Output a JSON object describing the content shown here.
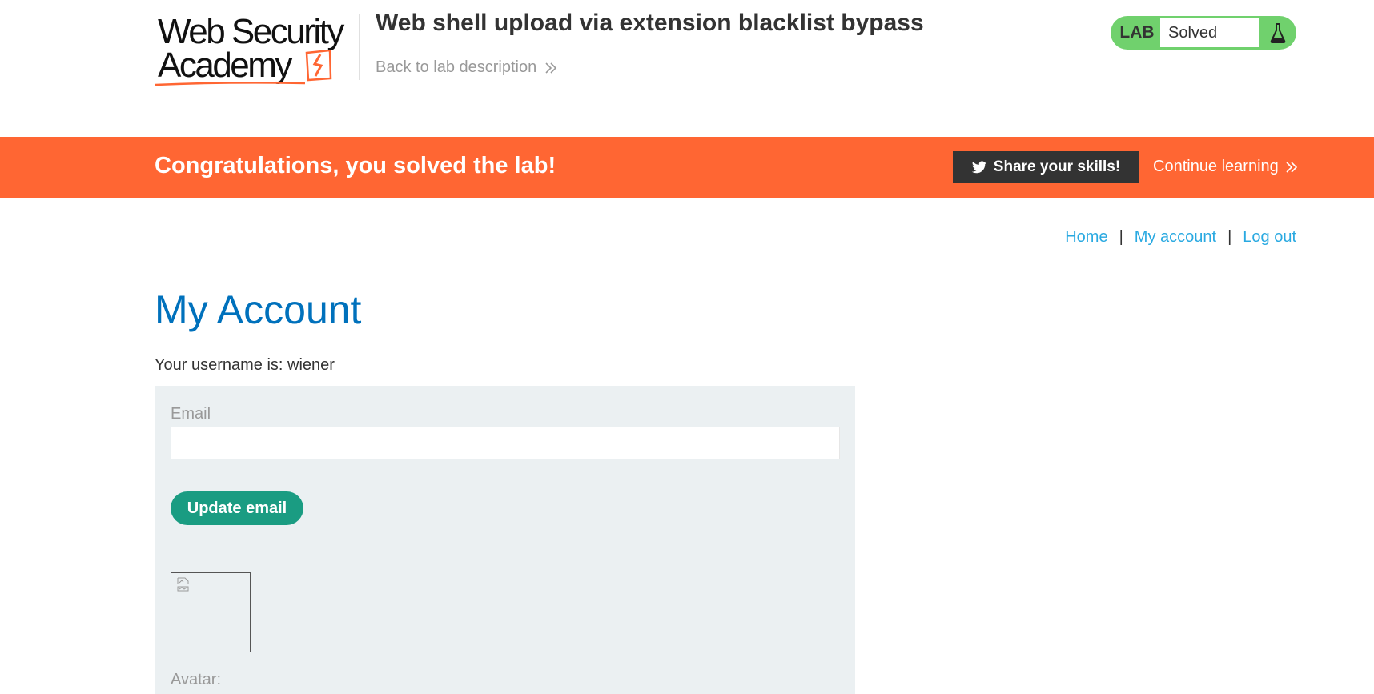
{
  "brand": {
    "line1": "Web Security",
    "line2": "Academy",
    "accent": "#ff6633"
  },
  "header": {
    "lab_title": "Web shell upload via extension blacklist bypass",
    "back_link": "Back to lab description",
    "back_icon": "double-chevron-right-icon"
  },
  "lab_status": {
    "label": "LAB",
    "state": "Solved",
    "icon": "flask-icon",
    "color": "#70d16d"
  },
  "banner": {
    "message": "Congratulations, you solved the lab!",
    "share_label": "Share your skills!",
    "share_icon": "twitter-icon",
    "continue_label": "Continue learning",
    "color": "#ff6633"
  },
  "nav": {
    "items": [
      {
        "label": "Home"
      },
      {
        "label": "My account"
      },
      {
        "label": "Log out"
      }
    ],
    "separator": "|"
  },
  "main": {
    "title": "My Account",
    "username_line": "Your username is: wiener",
    "email_label": "Email",
    "email_value": "",
    "update_button": "Update email",
    "avatar_label": "Avatar:",
    "avatar_icon": "broken-image-icon"
  }
}
